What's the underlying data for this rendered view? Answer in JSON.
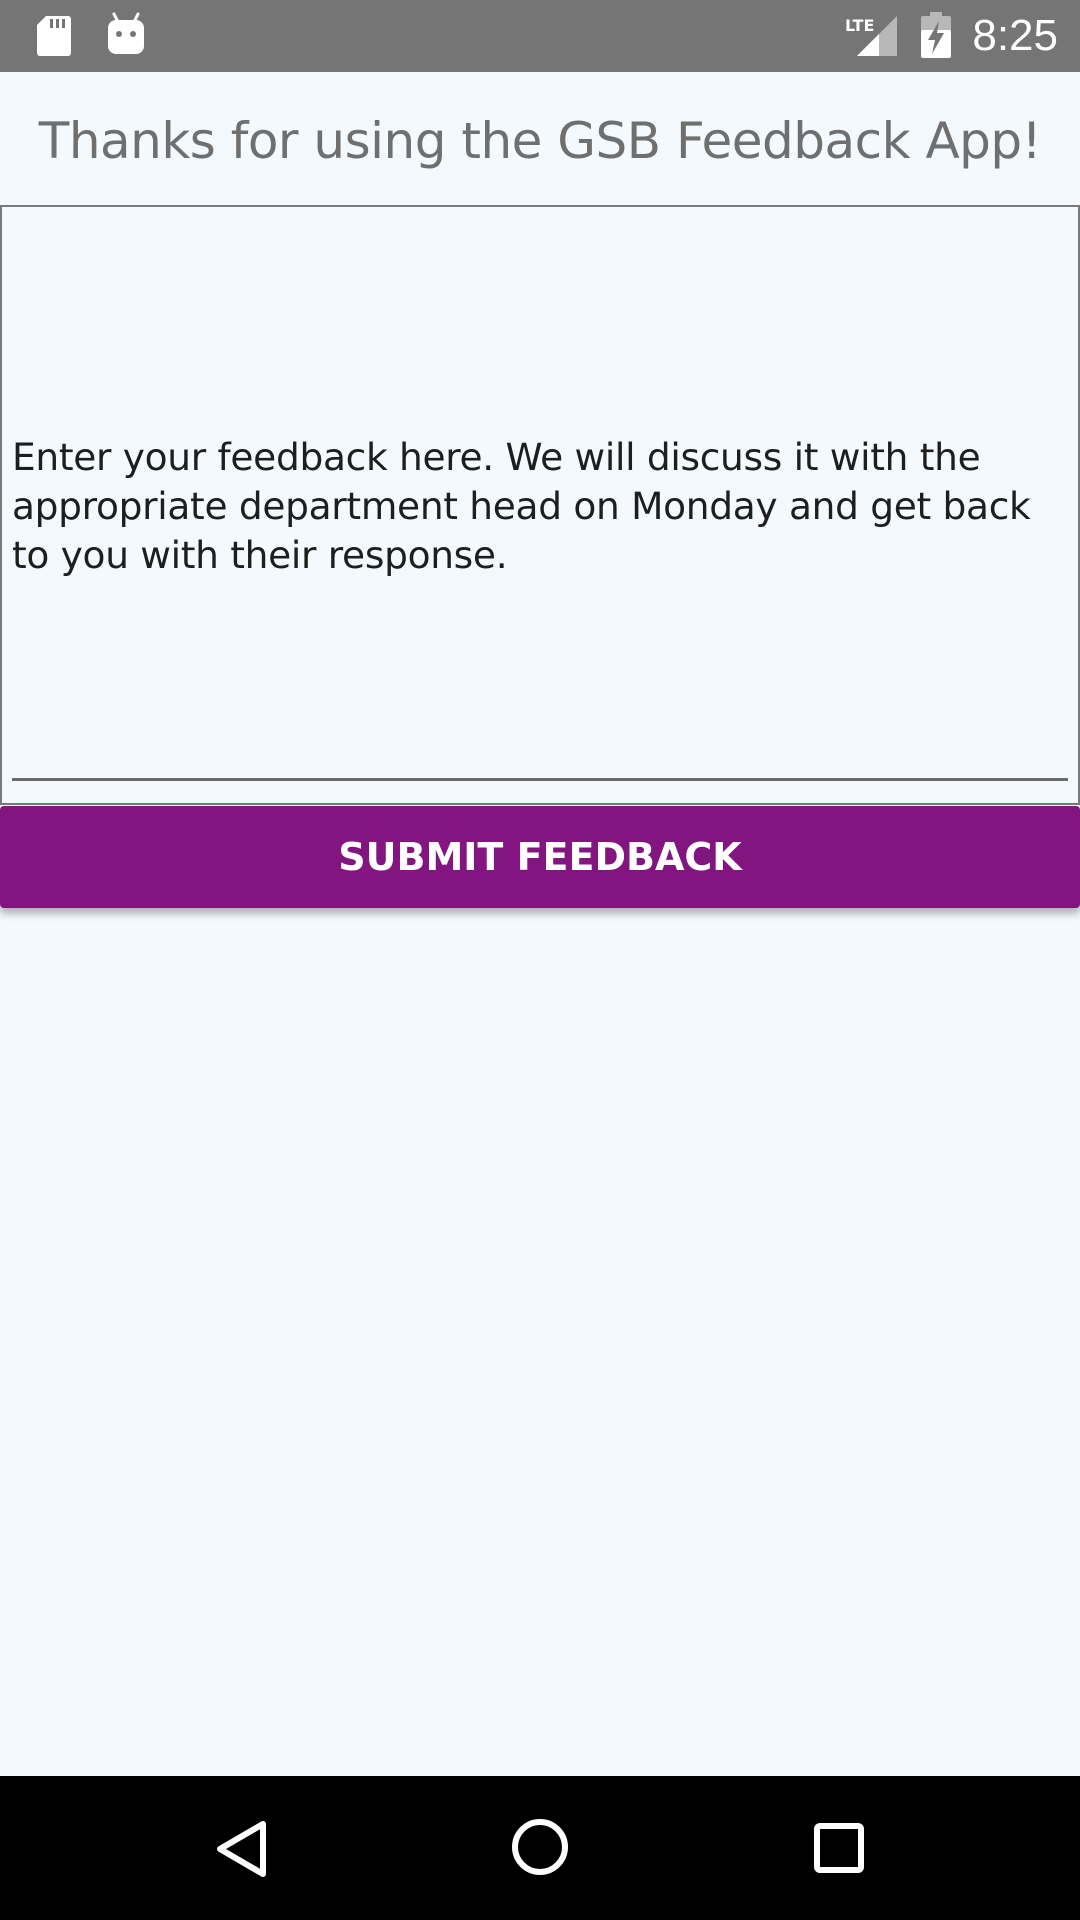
{
  "status_bar": {
    "time": "8:25",
    "network_label": "LTE",
    "left_icons": [
      "sd-card-icon",
      "android-icon"
    ],
    "right_icons": [
      "lte-signal-icon",
      "battery-charging-icon"
    ]
  },
  "page": {
    "title": "Thanks for using the GSB Feedback App!"
  },
  "feedback": {
    "placeholder": "Enter your feedback here. We will discuss it with the appropriate department head on Monday and get back to you with their response."
  },
  "actions": {
    "submit_label": "SUBMIT FEEDBACK"
  },
  "nav_bar": {
    "buttons": [
      "back-icon",
      "home-icon",
      "recents-icon"
    ]
  },
  "colors": {
    "accent": "#821580",
    "background": "#f3f9fd",
    "status_bar": "#757575",
    "nav_bar": "#000000"
  }
}
